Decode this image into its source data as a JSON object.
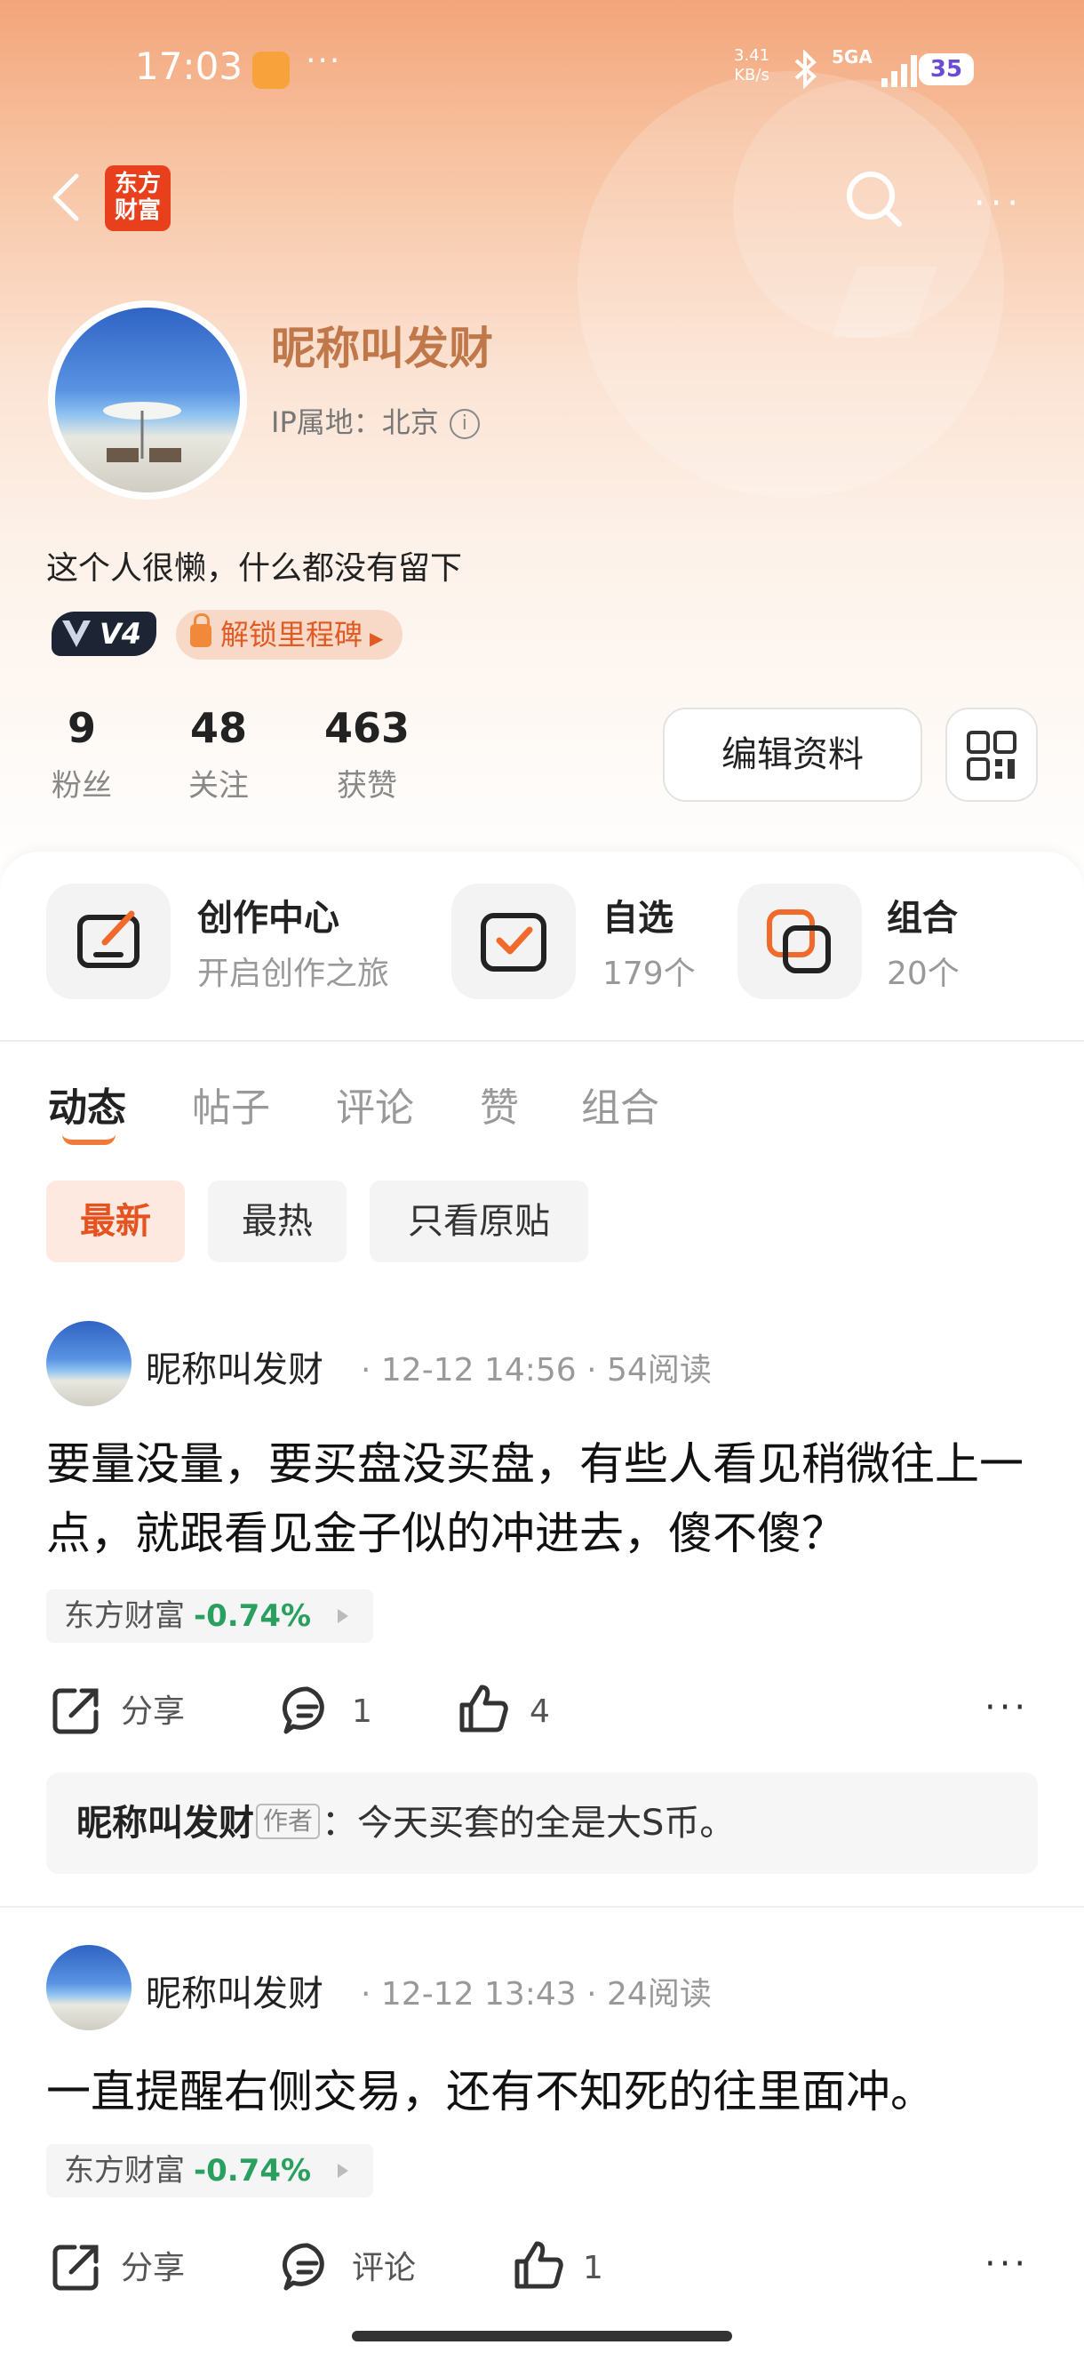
{
  "status_bar": {
    "time": "17:03",
    "dots": "···",
    "net_speed_value": "3.41",
    "net_speed_unit": "KB/s",
    "network": "5GA",
    "battery": "35"
  },
  "nav": {
    "logo_text": "东方财富"
  },
  "profile": {
    "nickname": "昵称叫发财",
    "ip_location": "IP属地：北京",
    "bio": "这个人很懒，什么都没有留下",
    "level": "V4",
    "milestone": "解锁里程碑",
    "stats": [
      {
        "value": "9",
        "label": "粉丝"
      },
      {
        "value": "48",
        "label": "关注"
      },
      {
        "value": "463",
        "label": "获赞"
      }
    ],
    "edit_button": "编辑资料"
  },
  "shortcuts": [
    {
      "title": "创作中心",
      "subtitle": "开启创作之旅",
      "icon": "edit-icon"
    },
    {
      "title": "自选",
      "subtitle": "179个",
      "icon": "checkbox-icon"
    },
    {
      "title": "组合",
      "subtitle": "20个",
      "icon": "portfolio-icon"
    }
  ],
  "tabs": [
    "动态",
    "帖子",
    "评论",
    "赞",
    "组合"
  ],
  "active_tab": "动态",
  "filters": [
    "最新",
    "最热",
    "只看原贴"
  ],
  "posts": [
    {
      "author": "昵称叫发财",
      "meta": "·  12-12 14:56  ·  54阅读",
      "text": "要量没量，要买盘没买盘，有些人看见稍微往上一点，就跟看见金子似的冲进去，傻不傻？",
      "stock_name": "东方财富",
      "stock_pct": "-0.74%",
      "share": "分享",
      "comments": "1",
      "likes": "4",
      "reply_author": "昵称叫发财",
      "reply_tag": "作者",
      "reply_text": "：今天买套的全是大S币。"
    },
    {
      "author": "昵称叫发财",
      "meta": "·  12-12 13:43  ·  24阅读",
      "text": "一直提醒右侧交易，还有不知死的往里面冲。",
      "stock_name": "东方财富",
      "stock_pct": "-0.74%",
      "share": "分享",
      "comments": "评论",
      "likes": "1"
    }
  ],
  "colors": {
    "accent": "#e55320",
    "nickname": "#c0784b",
    "positive_change": "#2aa060"
  }
}
